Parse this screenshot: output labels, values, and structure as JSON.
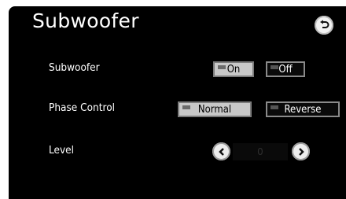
{
  "header": {
    "title": "Subwoofer",
    "back_icon": "back-arrow-icon"
  },
  "rows": {
    "subwoofer": {
      "label": "Subwoofer",
      "on_label": "On",
      "off_label": "Off",
      "selected": "On"
    },
    "phase": {
      "label": "Phase Control",
      "normal_label": "Normal",
      "reverse_label": "Reverse",
      "selected": "Normal"
    },
    "level": {
      "label": "Level",
      "value": "0",
      "decrease_icon": "chevron-left-icon",
      "increase_icon": "chevron-right-icon"
    }
  },
  "colors": {
    "background": "#000000",
    "selected_button": "#c8c8c8",
    "text": "#ffffff"
  }
}
